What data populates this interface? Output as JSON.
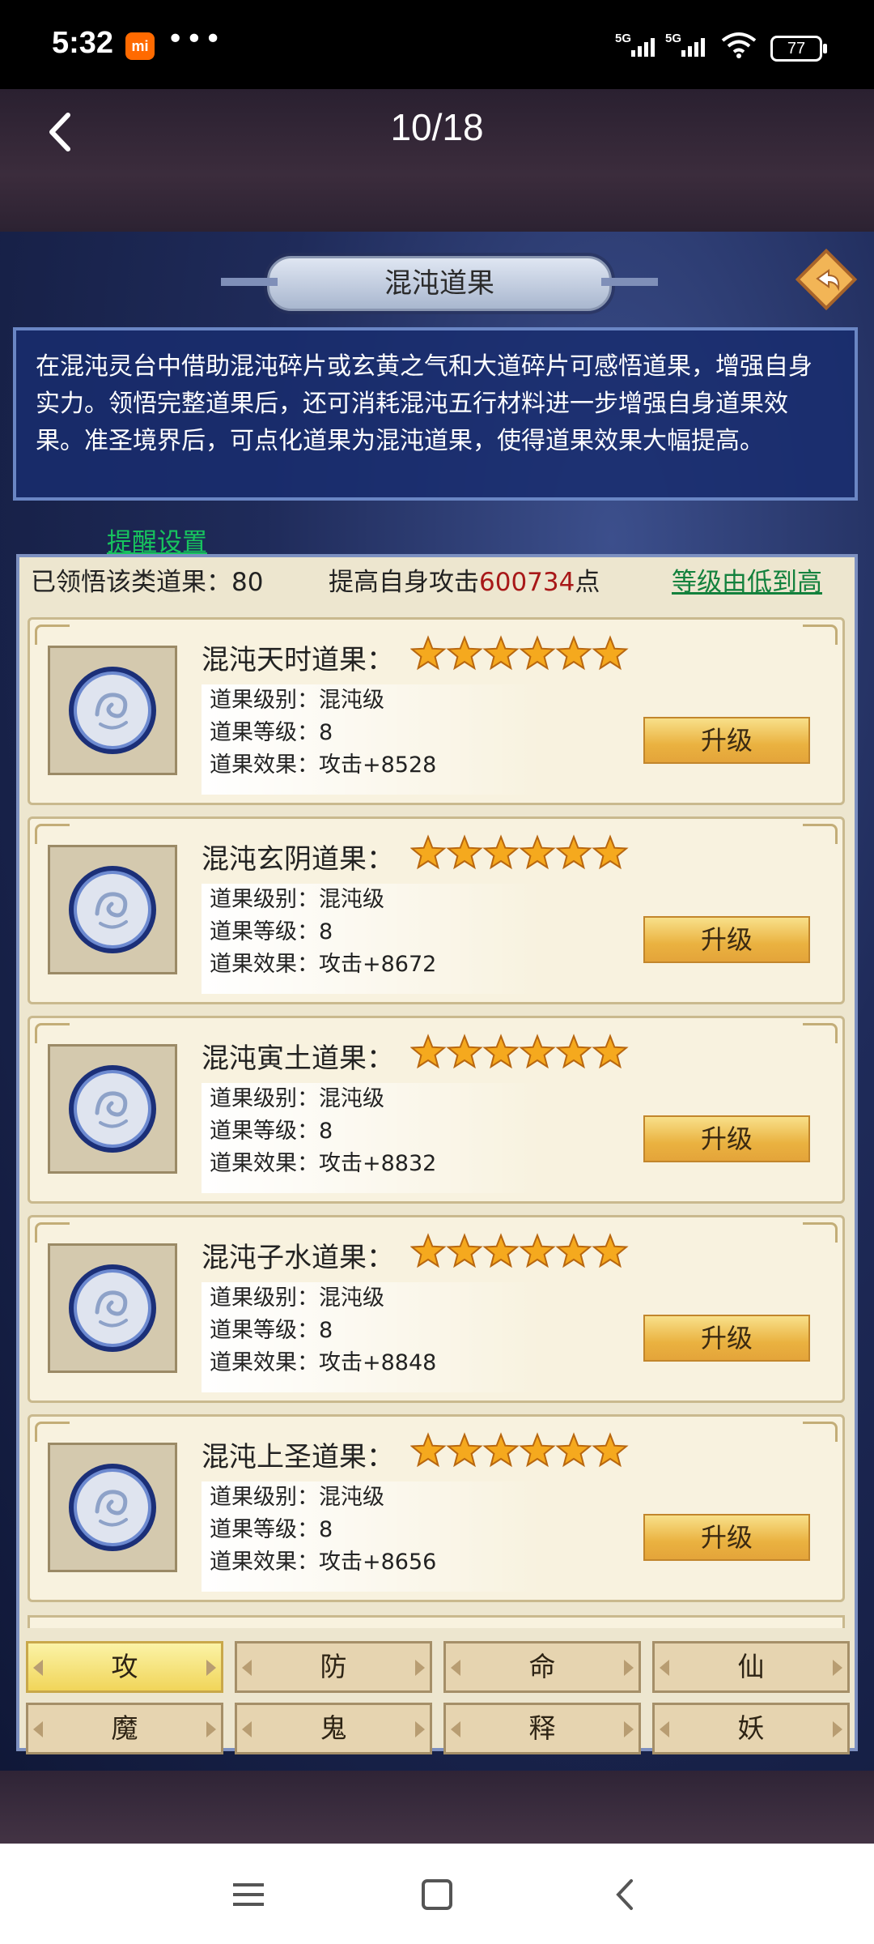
{
  "status_bar": {
    "time": "5:32",
    "mi_label": "mi",
    "dots": "•••",
    "network_1": "5G",
    "network_2": "5G",
    "battery": "77"
  },
  "header": {
    "page_counter": "10/18"
  },
  "panel": {
    "title": "混沌道果",
    "description": "在混沌灵台中借助混沌碎片或玄黄之气和大道碎片可感悟道果，增强自身实力。领悟完整道果后，还可消耗混沌五行材料进一步增强自身道果效果。准圣境界后，可点化道果为混沌道果，使得道果效果大幅提高。",
    "remind_link": "提醒设置",
    "summary": {
      "learned": "已领悟该类道果：80",
      "boost_prefix": "提高自身攻击",
      "boost_value": "600734",
      "boost_suffix": "点",
      "sort_link": "等级由低到高"
    }
  },
  "cards": [
    {
      "name": "混沌天时道果：",
      "stars": 6,
      "grade": "道果级别：混沌级",
      "level": "道果等级：8",
      "effect": "道果效果：攻击+8528",
      "button": "升级"
    },
    {
      "name": "混沌玄阴道果：",
      "stars": 6,
      "grade": "道果级别：混沌级",
      "level": "道果等级：8",
      "effect": "道果效果：攻击+8672",
      "button": "升级"
    },
    {
      "name": "混沌寅土道果：",
      "stars": 6,
      "grade": "道果级别：混沌级",
      "level": "道果等级：8",
      "effect": "道果效果：攻击+8832",
      "button": "升级"
    },
    {
      "name": "混沌子水道果：",
      "stars": 6,
      "grade": "道果级别：混沌级",
      "level": "道果等级：8",
      "effect": "道果效果：攻击+8848",
      "button": "升级"
    },
    {
      "name": "混沌上圣道果：",
      "stars": 6,
      "grade": "道果级别：混沌级",
      "level": "道果等级：8",
      "effect": "道果效果：攻击+8656",
      "button": "升级"
    }
  ],
  "tabs": [
    {
      "label": "攻",
      "active": true
    },
    {
      "label": "防",
      "active": false
    },
    {
      "label": "命",
      "active": false
    },
    {
      "label": "仙",
      "active": false
    },
    {
      "label": "魔",
      "active": false
    },
    {
      "label": "鬼",
      "active": false
    },
    {
      "label": "释",
      "active": false
    },
    {
      "label": "妖",
      "active": false
    }
  ],
  "colors": {
    "accent_green": "#13813d",
    "value_red": "#a81818",
    "button_gold": "#eab240"
  },
  "icons": {
    "back": "back-arrow-icon",
    "return": "return-arrow-icon",
    "nav_menu": "menu-icon",
    "nav_home": "home-icon",
    "nav_back": "back-icon"
  }
}
